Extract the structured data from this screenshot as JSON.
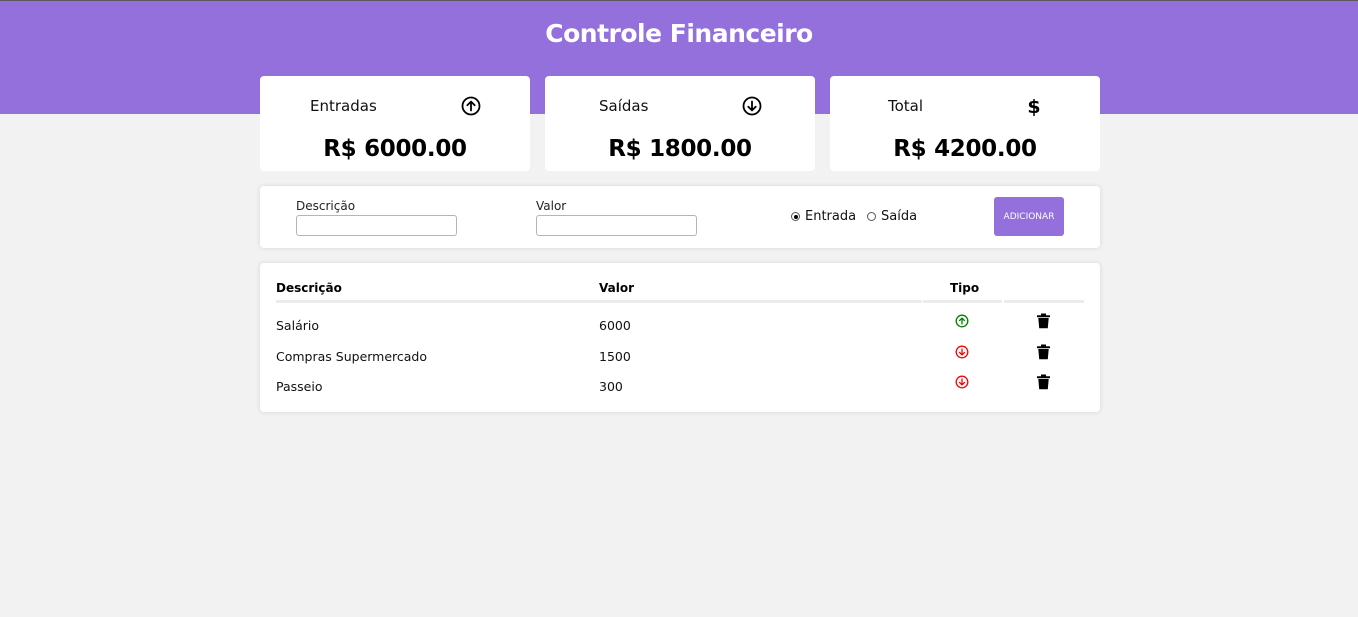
{
  "app": {
    "title": "Controle Financeiro"
  },
  "cards": [
    {
      "label": "Entradas",
      "icon": "arrow-up-circle-icon",
      "value": "R$ 6000.00"
    },
    {
      "label": "Saídas",
      "icon": "arrow-down-circle-icon",
      "value": "R$ 1800.00"
    },
    {
      "label": "Total",
      "icon": "dollar-icon",
      "value": "R$ 4200.00"
    }
  ],
  "form": {
    "descricao_label": "Descrição",
    "descricao_value": "",
    "valor_label": "Valor",
    "valor_value": "",
    "radio_entrada": "Entrada",
    "radio_saida": "Saída",
    "selected": "Entrada",
    "add_button": "ADICIONAR"
  },
  "table": {
    "headers": [
      "Descrição",
      "Valor",
      "Tipo",
      ""
    ],
    "rows": [
      {
        "descricao": "Salário",
        "valor": "6000",
        "tipo": "entrada",
        "tipo_icon": "arrow-up-circle-icon",
        "delete_icon": "trash-icon"
      },
      {
        "descricao": "Compras Supermercado",
        "valor": "1500",
        "tipo": "saida",
        "tipo_icon": "arrow-down-circle-icon",
        "delete_icon": "trash-icon"
      },
      {
        "descricao": "Passeio",
        "valor": "300",
        "tipo": "saida",
        "tipo_icon": "arrow-down-circle-icon",
        "delete_icon": "trash-icon"
      }
    ]
  },
  "colors": {
    "accent": "#9370db",
    "entrada": "#008000",
    "saida": "#ff0000",
    "background": "#f2f2f2"
  }
}
